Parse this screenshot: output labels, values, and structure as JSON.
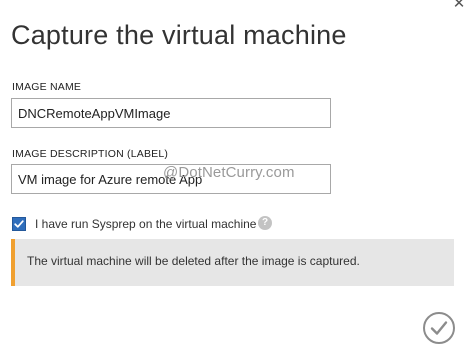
{
  "dialog": {
    "title": "Capture the virtual machine",
    "close_icon": "close-icon"
  },
  "image_name": {
    "label": "IMAGE NAME",
    "value": "DNCRemoteAppVMImage"
  },
  "image_description": {
    "label": "IMAGE DESCRIPTION (LABEL)",
    "value": "VM image for Azure remote App"
  },
  "watermark": "@DotNetCurry.com",
  "sysprep": {
    "checked": true,
    "label": "I have run Sysprep on the virtual machine",
    "help_icon": "question-mark-icon"
  },
  "notice": {
    "text": "The virtual machine will be deleted after the image is captured.",
    "accent_color": "#f0a030"
  },
  "footer": {
    "confirm_icon": "checkmark-icon"
  },
  "colors": {
    "checkbox": "#2f6ebc",
    "notice_background": "#e6e6e6"
  }
}
